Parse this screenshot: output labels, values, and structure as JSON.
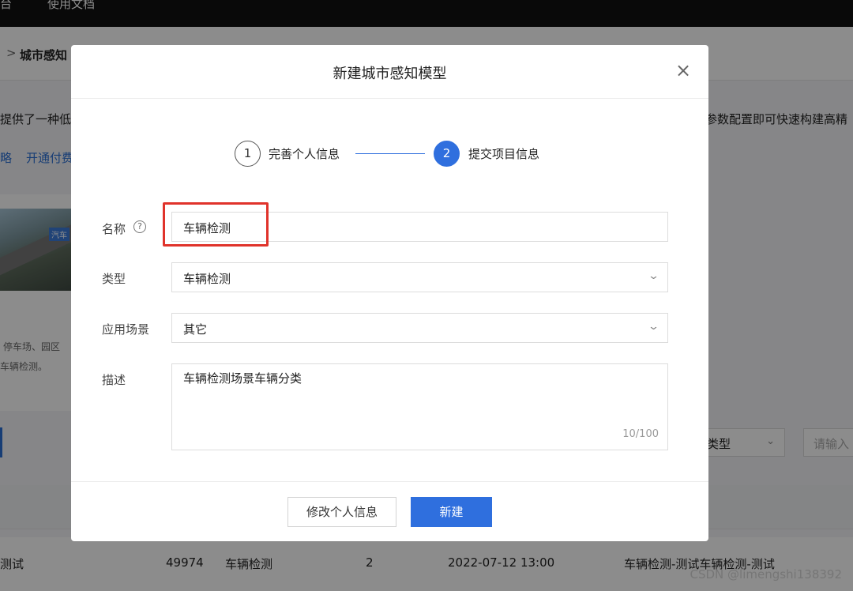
{
  "topbar": {
    "item_left": "台",
    "item_docs": "使用文档"
  },
  "breadcrumb": {
    "title": "城市感知"
  },
  "intro": {
    "left_text": "提供了一种低",
    "right_text": "参数配置即可快速构建高精"
  },
  "links": {
    "strategy": "略",
    "open_paid": "开通付费"
  },
  "card": {
    "image_tag": "汽车",
    "desc_line1": "停车场、园区",
    "desc_line2": "车辆检测。"
  },
  "filters": {
    "type_select": "类型",
    "search_placeholder": "请输入"
  },
  "table_row": {
    "name": "测试",
    "id": "49974",
    "type": "车辆检测",
    "count": "2",
    "time": "2022-07-12 13:00",
    "desc": "车辆检测-测试车辆检测-测试"
  },
  "watermark": "CSDN @limengshi138392",
  "modal": {
    "title": "新建城市感知模型",
    "steps": [
      {
        "num": "1",
        "label": "完善个人信息"
      },
      {
        "num": "2",
        "label": "提交项目信息"
      }
    ],
    "form": {
      "name_label": "名称",
      "name_value": "车辆检测",
      "type_label": "类型",
      "type_value": "车辆检测",
      "scene_label": "应用场景",
      "scene_value": "其它",
      "desc_label": "描述",
      "desc_value": "车辆检测场景车辆分类",
      "desc_count": "10/100"
    },
    "buttons": {
      "edit_profile": "修改个人信息",
      "create": "新建"
    }
  },
  "colors": {
    "primary": "#2f6fde",
    "highlight": "#e0332b"
  }
}
